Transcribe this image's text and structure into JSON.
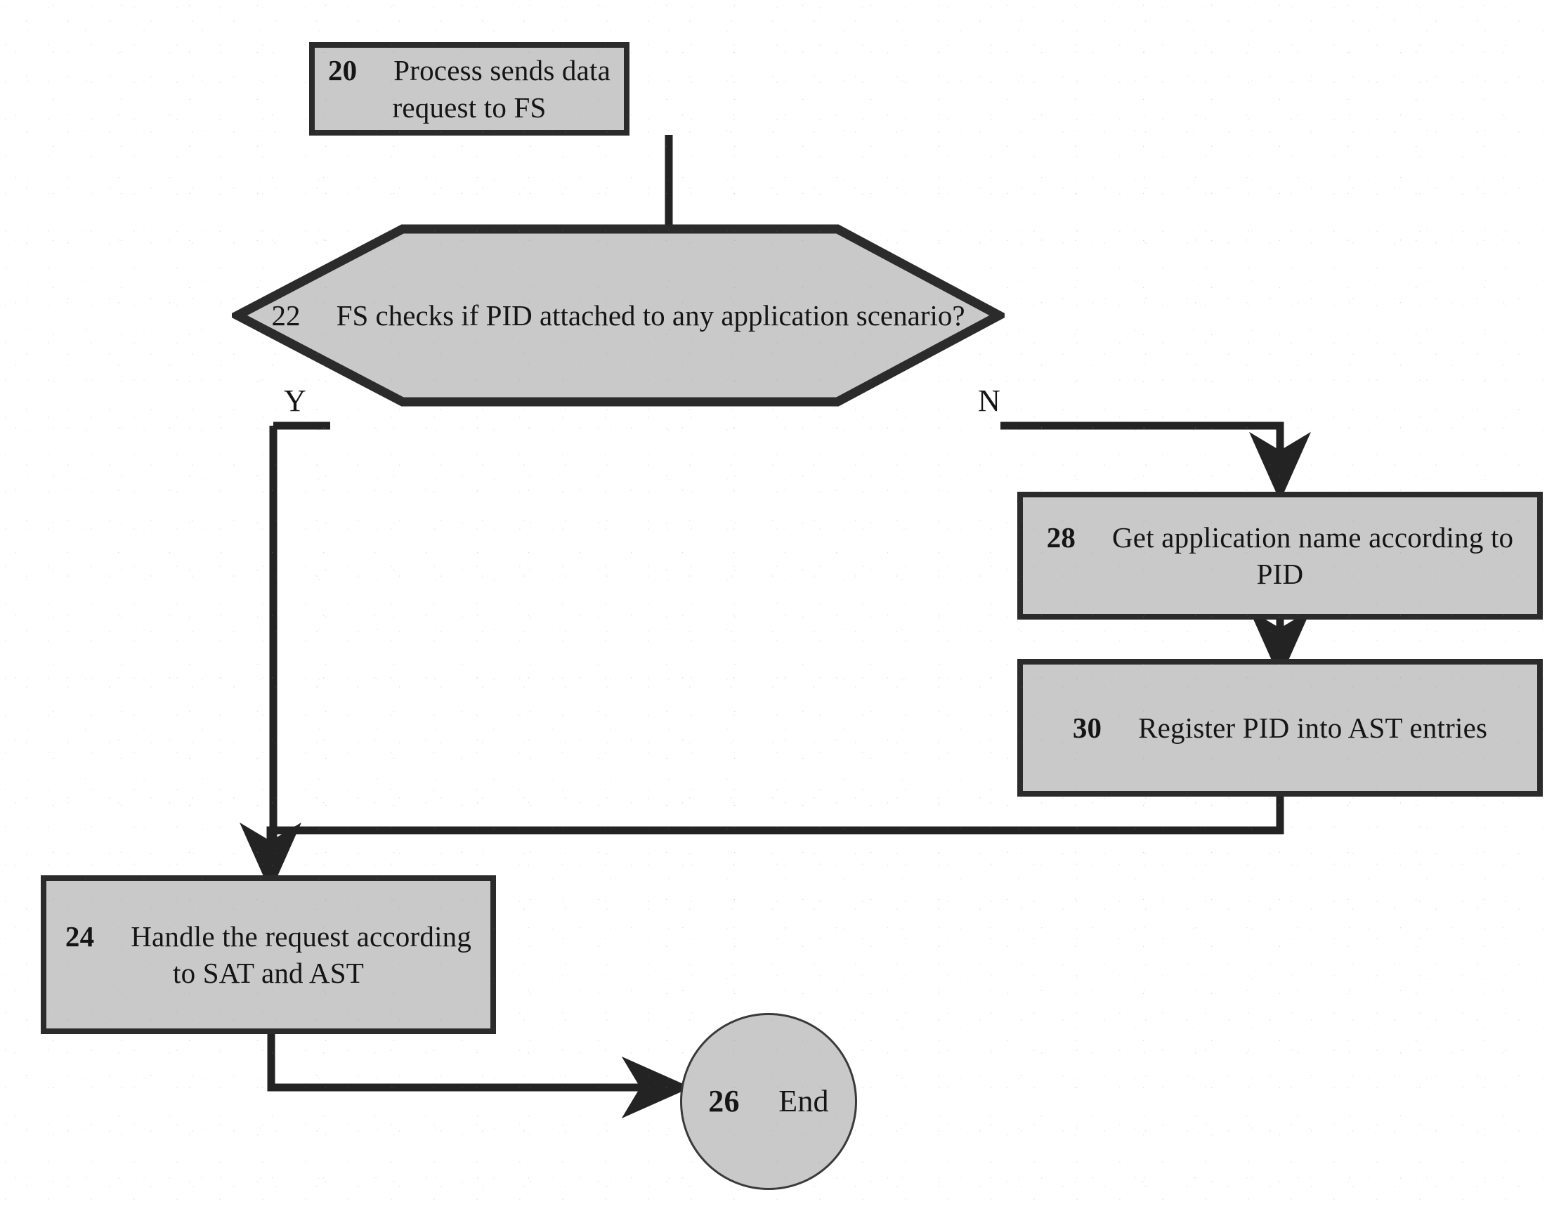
{
  "diagram": {
    "type": "flowchart",
    "title": "",
    "shape_fill": "#c9c9c9",
    "shape_stroke": "#2b2b2b",
    "background": "#ffffff",
    "nodes": [
      {
        "id": "n20",
        "shape": "process",
        "number": "20",
        "label": "Process sends data request to FS",
        "lines": [
          "20  Process sends data",
          "request to FS"
        ]
      },
      {
        "id": "n22",
        "shape": "decision-hexagon",
        "number": "22",
        "label": "FS checks if PID attached to any application scenario?",
        "lines": [
          "22  FS checks if PID",
          "attached to any",
          "application scenario?"
        ]
      },
      {
        "id": "n28",
        "shape": "process",
        "number": "28",
        "label": "Get application name according to PID",
        "lines": [
          "28  Get application name",
          "according to PID"
        ]
      },
      {
        "id": "n30",
        "shape": "process",
        "number": "30",
        "label": "Register PID into AST entries",
        "lines": [
          "30  Register PID into AST",
          "entries"
        ]
      },
      {
        "id": "n24",
        "shape": "process",
        "number": "24",
        "label": "Handle the request according to SAT and AST",
        "lines": [
          "24  Handle the request",
          "according to SAT and",
          "AST"
        ]
      },
      {
        "id": "n26",
        "shape": "terminator-circle",
        "number": "26",
        "label": "End",
        "lines": [
          "26  End"
        ]
      }
    ],
    "edge_labels": {
      "yes": "Y",
      "no": "N"
    },
    "edges": [
      {
        "from": "n20",
        "to": "n22",
        "label": ""
      },
      {
        "from": "n22",
        "to": "n24",
        "label": "Y"
      },
      {
        "from": "n22",
        "to": "n28",
        "label": "N"
      },
      {
        "from": "n28",
        "to": "n30",
        "label": ""
      },
      {
        "from": "n30",
        "to": "n24",
        "label": ""
      },
      {
        "from": "n24",
        "to": "n26",
        "label": ""
      }
    ]
  }
}
